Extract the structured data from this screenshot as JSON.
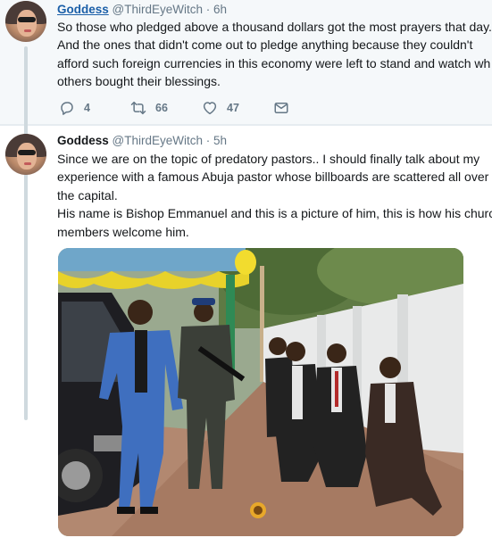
{
  "tweets": [
    {
      "author_name": "Goddess",
      "handle": "@ThirdEyeWitch",
      "separator": "·",
      "time": "6h",
      "lines": [
        "So those who pledged above a thousand dollars got the most prayers that day.",
        "And the ones that didn't come out to pledge anything because they couldn't",
        "afford such foreign currencies in this economy were left to stand and watch wh",
        "others bought their blessings."
      ],
      "actions": {
        "reply_icon": "reply-icon",
        "reply_count": "4",
        "retweet_icon": "retweet-icon",
        "retweet_count": "66",
        "like_icon": "heart-icon",
        "like_count": "47",
        "dm_icon": "envelope-icon"
      }
    },
    {
      "author_name": "Goddess",
      "handle": "@ThirdEyeWitch",
      "separator": "·",
      "time": "5h",
      "lines": [
        "Since we are on the topic of predatory pastors.. I should finally talk about my",
        "experience with a famous Abuja pastor whose billboards are scattered all over",
        "the capital.",
        "His name is Bishop Emmanuel and this is a picture of him, this is how his church",
        "members welcome him."
      ]
    }
  ],
  "colors": {
    "link": "#1b5fa8",
    "muted": "#657786",
    "highlight_bg": "#f5f8fa",
    "thread_line": "#cfd9de"
  }
}
